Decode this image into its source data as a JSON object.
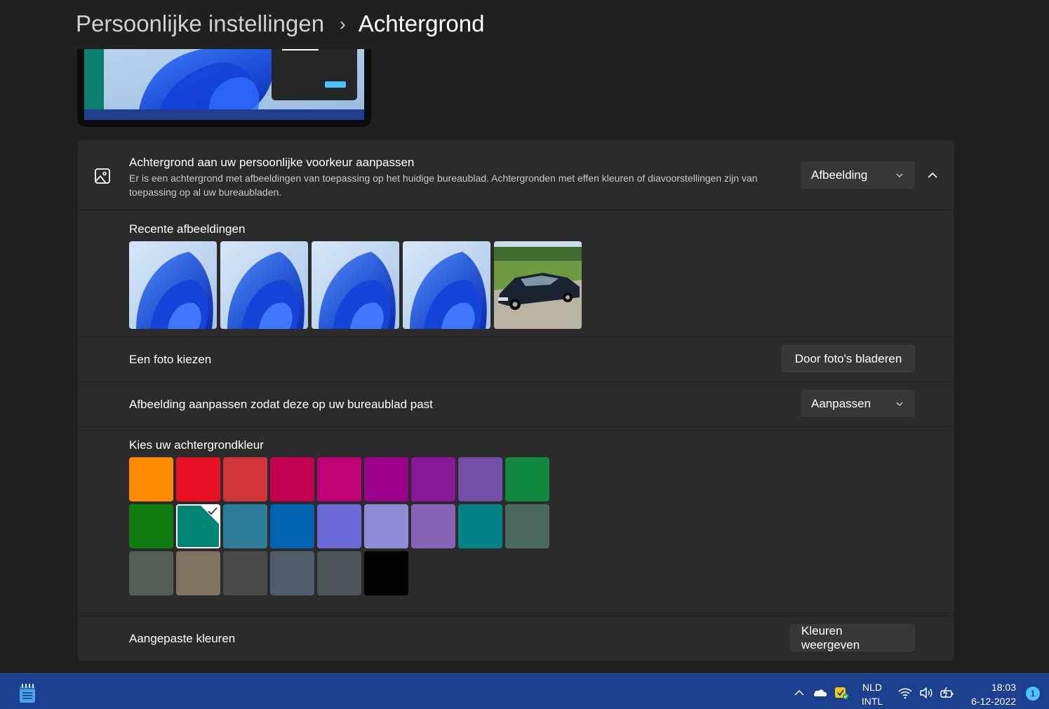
{
  "breadcrumb": {
    "parent": "Persoonlijke instellingen",
    "separator": "›",
    "current": "Achtergrond"
  },
  "preview": {
    "screen_color": "#0a7d6f",
    "accent_button_color": "#4cc2ff"
  },
  "background_setting": {
    "icon": "picture-icon",
    "title": "Achtergrond aan uw persoonlijke voorkeur aanpassen",
    "description": "Er is een achtergrond met afbeeldingen van toepassing op het huidige bureaublad. Achtergronden met effen kleuren of diavoorstellingen zijn van toepassing op al uw bureaubladen.",
    "dropdown_value": "Afbeelding",
    "expanded": true
  },
  "recent_images": {
    "label": "Recente afbeeldingen",
    "items": [
      {
        "kind": "bloom"
      },
      {
        "kind": "bloom"
      },
      {
        "kind": "bloom"
      },
      {
        "kind": "bloom"
      },
      {
        "kind": "car-photo"
      }
    ]
  },
  "choose_photo": {
    "label": "Een foto kiezen",
    "button": "Door foto's bladeren"
  },
  "fit": {
    "label": "Afbeelding aanpassen zodat deze op uw bureaublad past",
    "dropdown_value": "Aanpassen"
  },
  "background_color": {
    "label": "Kies uw achtergrondkleur",
    "selected_index": 10,
    "colors": [
      "#ff8c00",
      "#e81123",
      "#d13438",
      "#c30052",
      "#bf0077",
      "#9a0089",
      "#881798",
      "#744da9",
      "#10893e",
      "#107c10",
      "#018574",
      "#2d7d9a",
      "#0063b1",
      "#6b69d6",
      "#8e8cd8",
      "#8764b8",
      "#038387",
      "#486860",
      "#525e54",
      "#7e735f",
      "#4c4a48",
      "#515c6b",
      "#4a5459",
      "#000000"
    ]
  },
  "custom_colors": {
    "label": "Aangepaste kleuren",
    "button": "Kleuren weergeven"
  },
  "taskbar": {
    "language_line1": "NLD",
    "language_line2": "INTL",
    "time": "18:03",
    "date": "6-12-2022",
    "notification_count": "1",
    "color": "#1c3f90"
  }
}
